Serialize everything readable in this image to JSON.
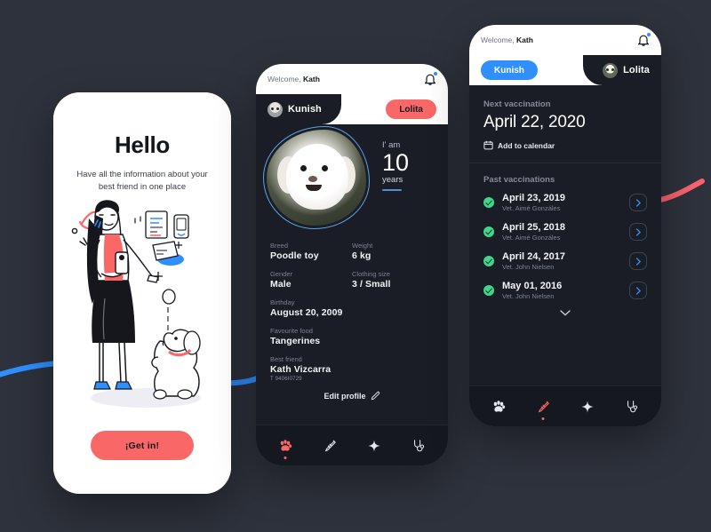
{
  "theme": {
    "background": "#2e323c",
    "coral": "#fa6767",
    "blue": "#2f8fff",
    "green": "#3fd68b",
    "dark_panel": "#1a1d26"
  },
  "screen_onboarding": {
    "title": "Hello",
    "subtitle": "Have all the information about your best friend in one place",
    "cta_label": "¡Get in!",
    "illustration_name": "woman-with-phone-and-poodle-illustration"
  },
  "screen_profile": {
    "topbar": {
      "welcome_prefix": "Welcome,",
      "user_name": "Kath",
      "bell_icon": "bell-icon"
    },
    "tabs": [
      {
        "label": "Kunish",
        "active": true
      },
      {
        "label": "Lolita",
        "active": false
      }
    ],
    "pet_photo_name": "kunish-dog-photo",
    "age": {
      "prefix": "I' am",
      "value": "10",
      "unit": "years"
    },
    "fields": [
      {
        "label": "Breed",
        "value": "Poodle toy"
      },
      {
        "label": "Weight",
        "value": "6 kg"
      },
      {
        "label": "Gender",
        "value": "Male"
      },
      {
        "label": "Clothing size",
        "value": "3 / Small"
      },
      {
        "label": "Birthday",
        "value": "August 20, 2009"
      },
      {
        "label": "Favourite food",
        "value": "Tangerines"
      },
      {
        "label": "Best friend",
        "value": "Kath Vizcarra",
        "sub": "T 9406I0729"
      }
    ],
    "edit_label": "Edit profile",
    "nav": [
      {
        "icon": "paw-icon",
        "active": true
      },
      {
        "icon": "syringe-icon",
        "active": false
      },
      {
        "icon": "sparkle-icon",
        "active": false
      },
      {
        "icon": "stethoscope-icon",
        "active": false
      }
    ]
  },
  "screen_vaccinations": {
    "topbar": {
      "welcome_prefix": "Welcome,",
      "user_name": "Kath",
      "bell_icon": "bell-icon"
    },
    "tabs": [
      {
        "label": "Kunish",
        "active": false
      },
      {
        "label": "Lolita",
        "active": true
      }
    ],
    "next": {
      "section_label": "Next vaccination",
      "date": "April 22, 2020",
      "add_to_calendar_label": "Add to calendar",
      "calendar_icon": "calendar-icon"
    },
    "past": {
      "section_label": "Past vaccinations",
      "items": [
        {
          "date": "April 23, 2019",
          "vet": "Vet. Aimé Gonzáles",
          "status": "completed"
        },
        {
          "date": "April 25, 2018",
          "vet": "Vet. Aimé Gonzáles",
          "status": "completed"
        },
        {
          "date": "April 24, 2017",
          "vet": "Vet. John Nielsen",
          "status": "completed"
        },
        {
          "date": "May 01, 2016",
          "vet": "Vet. John Nielsen",
          "status": "completed"
        }
      ],
      "expand_icon": "chevron-down-icon"
    },
    "nav": [
      {
        "icon": "paw-icon",
        "active": false
      },
      {
        "icon": "syringe-icon",
        "active": true
      },
      {
        "icon": "sparkle-icon",
        "active": false
      },
      {
        "icon": "stethoscope-icon",
        "active": false
      }
    ]
  }
}
